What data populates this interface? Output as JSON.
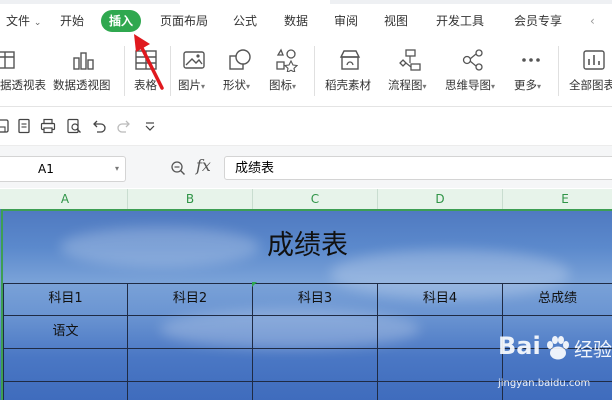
{
  "menu": {
    "file": "文件",
    "start": "开始",
    "insert": "插入",
    "page_layout": "页面布局",
    "formula": "公式",
    "data": "数据",
    "review": "审阅",
    "view": "视图",
    "dev_tools": "开发工具",
    "member": "会员专享",
    "active_color": "#2fa84f"
  },
  "ribbon": {
    "pivot_table": "据透视表",
    "pivot_chart": "数据透视图",
    "table": "表格",
    "picture": "图片",
    "shape": "形状",
    "icon": "图标",
    "daoke": "稻壳素材",
    "flowchart": "流程图",
    "mindmap": "思维导图",
    "more": "更多",
    "all_charts": "全部图表"
  },
  "formula_bar": {
    "cell_ref": "A1",
    "fx": "fx",
    "content": "成绩表"
  },
  "columns": [
    "A",
    "B",
    "C",
    "D",
    "E"
  ],
  "sheet": {
    "title": "成绩表",
    "headers": [
      "科目1",
      "科目2",
      "科目3",
      "科目4",
      "总成绩"
    ],
    "row1_first": "语文"
  },
  "watermark": {
    "brand": "Bai",
    "brand_suffix": "经验",
    "url": "jingyan.baidu.com"
  }
}
